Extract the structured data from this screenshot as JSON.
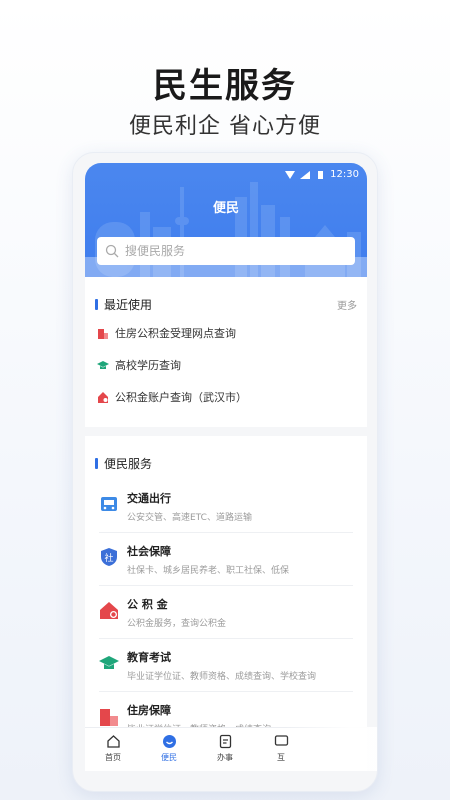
{
  "hero": {
    "title": "民生服务",
    "subtitle": "便民利企 省心方便"
  },
  "status_bar": {
    "time": "12:30"
  },
  "header": {
    "title": "便民"
  },
  "search": {
    "placeholder": "搜便民服务"
  },
  "recent": {
    "title": "最近使用",
    "more": "更多",
    "items": [
      {
        "label": "住房公积金受理网点查询",
        "icon": "house-icon",
        "color": "#e4474b"
      },
      {
        "label": "高校学历查询",
        "icon": "graduation-cap-icon",
        "color": "#1fa67a"
      },
      {
        "label": "公积金账户查询（武汉市）",
        "icon": "home-fund-icon",
        "color": "#e4474b"
      }
    ]
  },
  "services": {
    "title": "便民服务",
    "items": [
      {
        "name": "交通出行",
        "desc": "公安交管、高速ETC、道路运输",
        "icon": "bus-icon",
        "color": "#3d8ae6"
      },
      {
        "name": "社会保障",
        "desc": "社保卡、城乡居民养老、职工社保、低保",
        "icon": "social-security-shield-icon",
        "color": "#3b6fd8",
        "glyph": "社"
      },
      {
        "name": "公 积 金",
        "desc": "公积金服务，查询公积金",
        "icon": "housing-fund-icon",
        "color": "#e4474b"
      },
      {
        "name": "教育考试",
        "desc": "毕业证学位证、教师资格、成绩查询、学校查询",
        "icon": "graduation-cap-icon",
        "color": "#1fa67a"
      },
      {
        "name": "住房保障",
        "desc": "毕业证学位证、教师资格、成绩查询、",
        "icon": "housing-guarantee-icon",
        "color": "#e4474b"
      }
    ]
  },
  "tabbar": {
    "items": [
      {
        "label": "首页",
        "icon": "home-icon"
      },
      {
        "label": "便民",
        "icon": "smile-icon",
        "active": true
      },
      {
        "label": "办事",
        "icon": "document-icon"
      },
      {
        "label": "互",
        "icon": "chat-icon"
      }
    ]
  },
  "colors": {
    "primary": "#3f7ded",
    "accent_red": "#e4474b",
    "accent_green": "#1fa67a"
  }
}
